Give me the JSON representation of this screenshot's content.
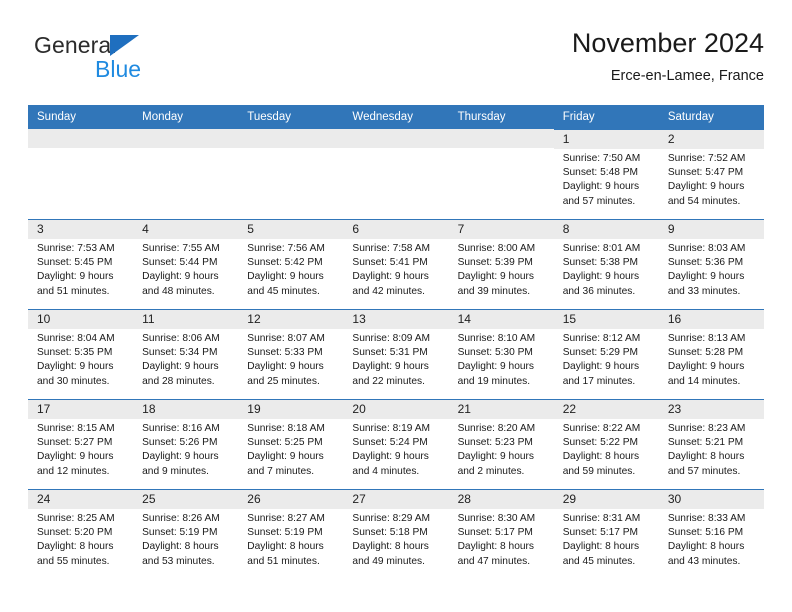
{
  "brand": {
    "name_part1": "General",
    "name_part2": "Blue",
    "triangle_color": "#1f6fbf",
    "blue_text_color": "#1f8ae0"
  },
  "header": {
    "title": "November 2024",
    "subtitle": "Erce-en-Lamee, France"
  },
  "theme": {
    "header_blue": "#3176b9",
    "daynum_background": "#ebebeb",
    "row_divider": "#3176b9"
  },
  "weekdays": [
    "Sunday",
    "Monday",
    "Tuesday",
    "Wednesday",
    "Thursday",
    "Friday",
    "Saturday"
  ],
  "weeks": [
    [
      {
        "day": "",
        "blank": true
      },
      {
        "day": "",
        "blank": true
      },
      {
        "day": "",
        "blank": true
      },
      {
        "day": "",
        "blank": true
      },
      {
        "day": "",
        "blank": true
      },
      {
        "day": "1",
        "sunrise": "Sunrise: 7:50 AM",
        "sunset": "Sunset: 5:48 PM",
        "daylight1": "Daylight: 9 hours",
        "daylight2": "and 57 minutes."
      },
      {
        "day": "2",
        "sunrise": "Sunrise: 7:52 AM",
        "sunset": "Sunset: 5:47 PM",
        "daylight1": "Daylight: 9 hours",
        "daylight2": "and 54 minutes."
      }
    ],
    [
      {
        "day": "3",
        "sunrise": "Sunrise: 7:53 AM",
        "sunset": "Sunset: 5:45 PM",
        "daylight1": "Daylight: 9 hours",
        "daylight2": "and 51 minutes."
      },
      {
        "day": "4",
        "sunrise": "Sunrise: 7:55 AM",
        "sunset": "Sunset: 5:44 PM",
        "daylight1": "Daylight: 9 hours",
        "daylight2": "and 48 minutes."
      },
      {
        "day": "5",
        "sunrise": "Sunrise: 7:56 AM",
        "sunset": "Sunset: 5:42 PM",
        "daylight1": "Daylight: 9 hours",
        "daylight2": "and 45 minutes."
      },
      {
        "day": "6",
        "sunrise": "Sunrise: 7:58 AM",
        "sunset": "Sunset: 5:41 PM",
        "daylight1": "Daylight: 9 hours",
        "daylight2": "and 42 minutes."
      },
      {
        "day": "7",
        "sunrise": "Sunrise: 8:00 AM",
        "sunset": "Sunset: 5:39 PM",
        "daylight1": "Daylight: 9 hours",
        "daylight2": "and 39 minutes."
      },
      {
        "day": "8",
        "sunrise": "Sunrise: 8:01 AM",
        "sunset": "Sunset: 5:38 PM",
        "daylight1": "Daylight: 9 hours",
        "daylight2": "and 36 minutes."
      },
      {
        "day": "9",
        "sunrise": "Sunrise: 8:03 AM",
        "sunset": "Sunset: 5:36 PM",
        "daylight1": "Daylight: 9 hours",
        "daylight2": "and 33 minutes."
      }
    ],
    [
      {
        "day": "10",
        "sunrise": "Sunrise: 8:04 AM",
        "sunset": "Sunset: 5:35 PM",
        "daylight1": "Daylight: 9 hours",
        "daylight2": "and 30 minutes."
      },
      {
        "day": "11",
        "sunrise": "Sunrise: 8:06 AM",
        "sunset": "Sunset: 5:34 PM",
        "daylight1": "Daylight: 9 hours",
        "daylight2": "and 28 minutes."
      },
      {
        "day": "12",
        "sunrise": "Sunrise: 8:07 AM",
        "sunset": "Sunset: 5:33 PM",
        "daylight1": "Daylight: 9 hours",
        "daylight2": "and 25 minutes."
      },
      {
        "day": "13",
        "sunrise": "Sunrise: 8:09 AM",
        "sunset": "Sunset: 5:31 PM",
        "daylight1": "Daylight: 9 hours",
        "daylight2": "and 22 minutes."
      },
      {
        "day": "14",
        "sunrise": "Sunrise: 8:10 AM",
        "sunset": "Sunset: 5:30 PM",
        "daylight1": "Daylight: 9 hours",
        "daylight2": "and 19 minutes."
      },
      {
        "day": "15",
        "sunrise": "Sunrise: 8:12 AM",
        "sunset": "Sunset: 5:29 PM",
        "daylight1": "Daylight: 9 hours",
        "daylight2": "and 17 minutes."
      },
      {
        "day": "16",
        "sunrise": "Sunrise: 8:13 AM",
        "sunset": "Sunset: 5:28 PM",
        "daylight1": "Daylight: 9 hours",
        "daylight2": "and 14 minutes."
      }
    ],
    [
      {
        "day": "17",
        "sunrise": "Sunrise: 8:15 AM",
        "sunset": "Sunset: 5:27 PM",
        "daylight1": "Daylight: 9 hours",
        "daylight2": "and 12 minutes."
      },
      {
        "day": "18",
        "sunrise": "Sunrise: 8:16 AM",
        "sunset": "Sunset: 5:26 PM",
        "daylight1": "Daylight: 9 hours",
        "daylight2": "and 9 minutes."
      },
      {
        "day": "19",
        "sunrise": "Sunrise: 8:18 AM",
        "sunset": "Sunset: 5:25 PM",
        "daylight1": "Daylight: 9 hours",
        "daylight2": "and 7 minutes."
      },
      {
        "day": "20",
        "sunrise": "Sunrise: 8:19 AM",
        "sunset": "Sunset: 5:24 PM",
        "daylight1": "Daylight: 9 hours",
        "daylight2": "and 4 minutes."
      },
      {
        "day": "21",
        "sunrise": "Sunrise: 8:20 AM",
        "sunset": "Sunset: 5:23 PM",
        "daylight1": "Daylight: 9 hours",
        "daylight2": "and 2 minutes."
      },
      {
        "day": "22",
        "sunrise": "Sunrise: 8:22 AM",
        "sunset": "Sunset: 5:22 PM",
        "daylight1": "Daylight: 8 hours",
        "daylight2": "and 59 minutes."
      },
      {
        "day": "23",
        "sunrise": "Sunrise: 8:23 AM",
        "sunset": "Sunset: 5:21 PM",
        "daylight1": "Daylight: 8 hours",
        "daylight2": "and 57 minutes."
      }
    ],
    [
      {
        "day": "24",
        "sunrise": "Sunrise: 8:25 AM",
        "sunset": "Sunset: 5:20 PM",
        "daylight1": "Daylight: 8 hours",
        "daylight2": "and 55 minutes."
      },
      {
        "day": "25",
        "sunrise": "Sunrise: 8:26 AM",
        "sunset": "Sunset: 5:19 PM",
        "daylight1": "Daylight: 8 hours",
        "daylight2": "and 53 minutes."
      },
      {
        "day": "26",
        "sunrise": "Sunrise: 8:27 AM",
        "sunset": "Sunset: 5:19 PM",
        "daylight1": "Daylight: 8 hours",
        "daylight2": "and 51 minutes."
      },
      {
        "day": "27",
        "sunrise": "Sunrise: 8:29 AM",
        "sunset": "Sunset: 5:18 PM",
        "daylight1": "Daylight: 8 hours",
        "daylight2": "and 49 minutes."
      },
      {
        "day": "28",
        "sunrise": "Sunrise: 8:30 AM",
        "sunset": "Sunset: 5:17 PM",
        "daylight1": "Daylight: 8 hours",
        "daylight2": "and 47 minutes."
      },
      {
        "day": "29",
        "sunrise": "Sunrise: 8:31 AM",
        "sunset": "Sunset: 5:17 PM",
        "daylight1": "Daylight: 8 hours",
        "daylight2": "and 45 minutes."
      },
      {
        "day": "30",
        "sunrise": "Sunrise: 8:33 AM",
        "sunset": "Sunset: 5:16 PM",
        "daylight1": "Daylight: 8 hours",
        "daylight2": "and 43 minutes."
      }
    ]
  ]
}
